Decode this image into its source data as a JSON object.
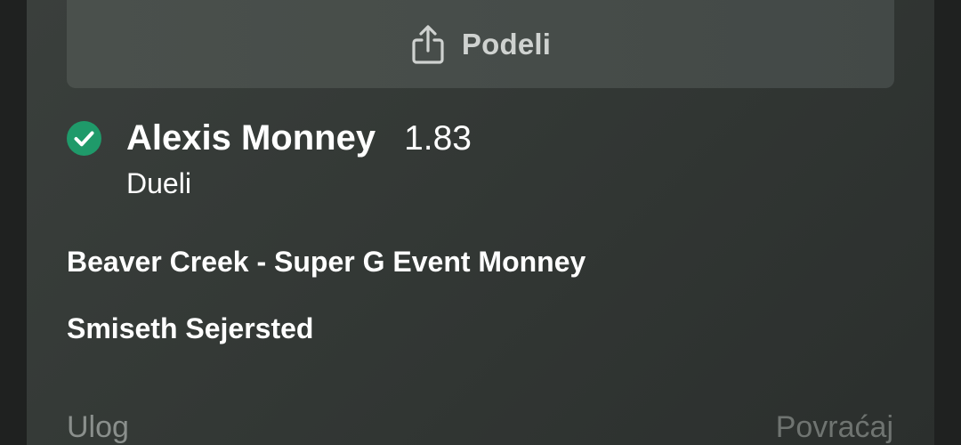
{
  "share": {
    "label": "Podeli",
    "icon": "share-icon"
  },
  "selection": {
    "status_icon": "check-circle-icon",
    "status_color": "#1f9a6a",
    "name": "Alexis Monney",
    "odds": "1.83",
    "market": "Dueli"
  },
  "event": {
    "name": "Beaver Creek - Super G Event Monney",
    "opponent": "Smiseth Sejersted"
  },
  "footer": {
    "stake_label": "Ulog",
    "return_label": "Povraćaj"
  }
}
